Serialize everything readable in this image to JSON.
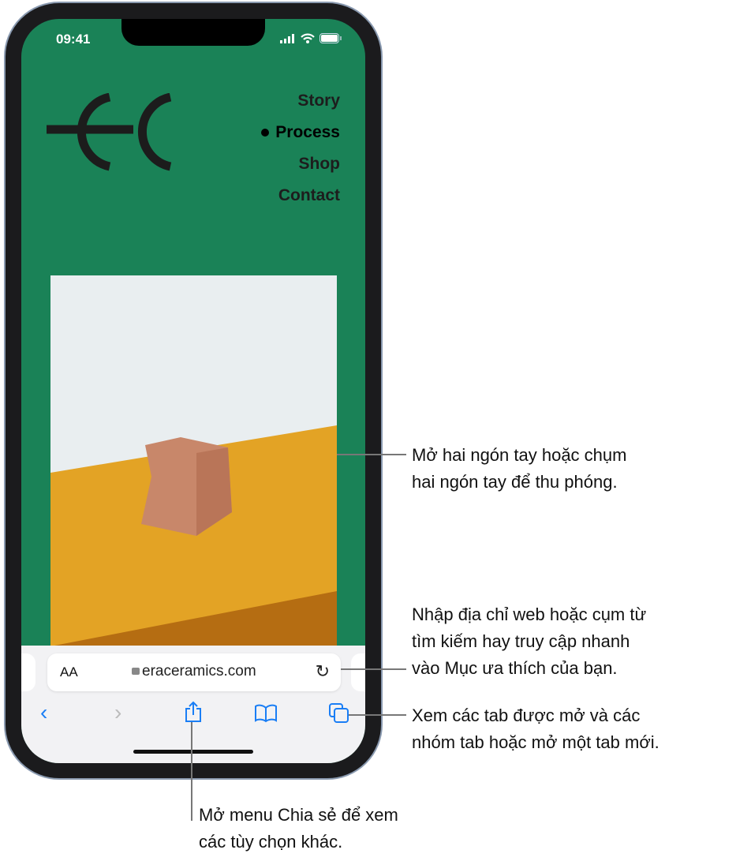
{
  "status_bar": {
    "time": "09:41"
  },
  "site": {
    "nav": [
      "Story",
      "Process",
      "Shop",
      "Contact"
    ],
    "active": "Process",
    "logo": "EC",
    "bg_color": "#1a8257"
  },
  "browser": {
    "text_size_label": "AA",
    "url": "eraceramics.com",
    "accent": "#1a7ef5"
  },
  "callouts": {
    "zoom": [
      "Mở hai ngón tay hoặc chụm",
      "hai ngón tay để thu phóng."
    ],
    "address": [
      "Nhập địa chỉ web hoặc cụm từ",
      "tìm kiếm hay truy cập nhanh",
      "vào Mục ưa thích của bạn."
    ],
    "tabs": [
      "Xem các tab được mở và các",
      "nhóm tab hoặc mở một tab mới."
    ],
    "share": [
      "Mở menu Chia sẻ để xem",
      "các tùy chọn khác."
    ]
  }
}
